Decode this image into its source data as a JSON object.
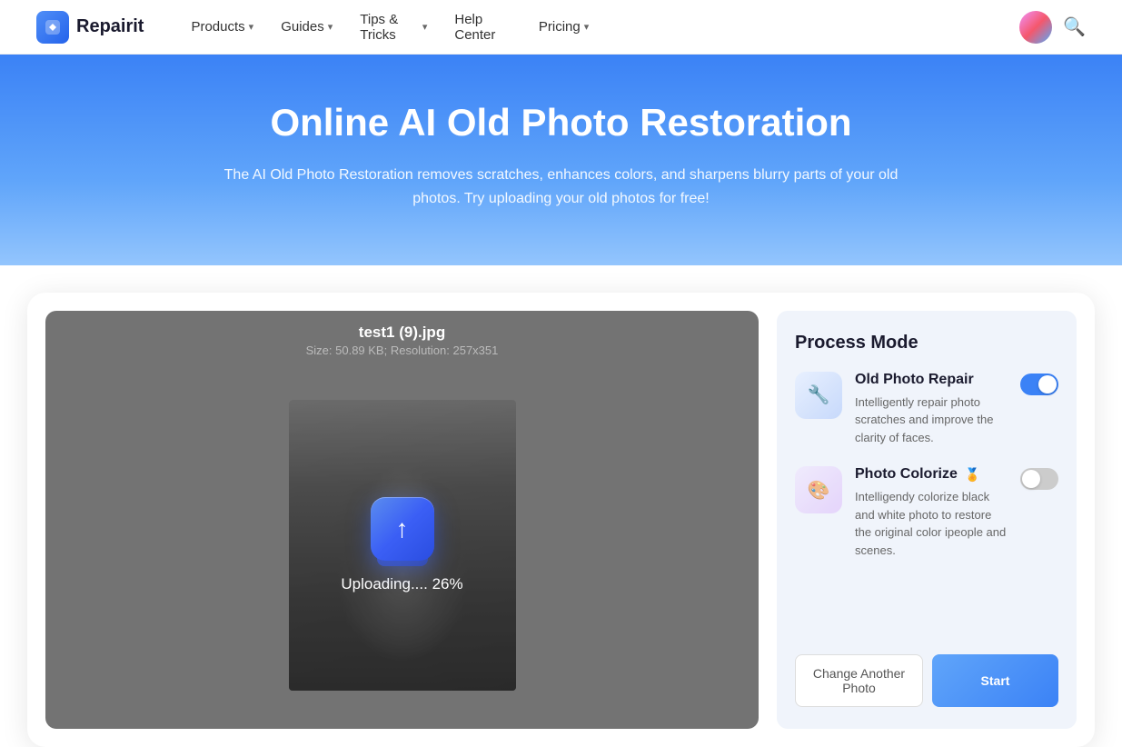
{
  "navbar": {
    "logo_text": "Repairit",
    "logo_icon": "R",
    "items": [
      {
        "label": "Products",
        "has_dropdown": true
      },
      {
        "label": "Guides",
        "has_dropdown": true
      },
      {
        "label": "Tips & Tricks",
        "has_dropdown": true
      },
      {
        "label": "Help Center",
        "has_dropdown": false
      },
      {
        "label": "Pricing",
        "has_dropdown": true
      }
    ]
  },
  "hero": {
    "title": "Online AI Old Photo Restoration",
    "subtitle": "The AI Old Photo Restoration removes scratches, enhances colors, and sharpens blurry parts of your old photos. Try uploading your old photos for free!"
  },
  "photo_area": {
    "filename": "test1 (9).jpg",
    "meta": "Size: 50.89 KB; Resolution: 257x351",
    "upload_status": "Uploading.... 26%"
  },
  "sidebar": {
    "process_mode_title": "Process Mode",
    "modes": [
      {
        "label": "Old Photo Repair",
        "icon": "repair",
        "desc": "Intelligently repair photo scratches and improve the clarity of faces.",
        "toggle": "on",
        "badge": ""
      },
      {
        "label": "Photo Colorize",
        "icon": "colorize",
        "desc": "Intelligendy colorize black and white photo to restore the original color ipeople and scenes.",
        "toggle": "off",
        "badge": "🏅"
      }
    ],
    "btn_change": "Change Another Photo",
    "btn_start": "Start"
  },
  "icons": {
    "search": "🔍",
    "chevron": "▾"
  }
}
